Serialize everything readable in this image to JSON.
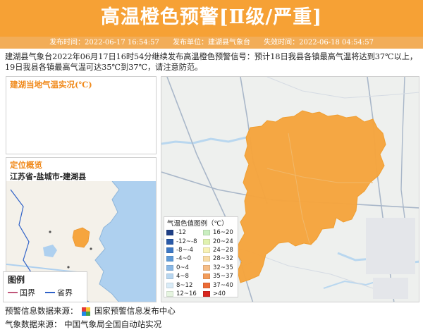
{
  "header": {
    "title": "高温橙色预警[Ⅱ级/严重]",
    "publish_time": "发布时间：2022-06-17 16:54:57",
    "publisher": "发布单位：建湖县气象台",
    "expire_time": "失效时间：2022-06-18 04:54:57"
  },
  "description": "建湖县气象台2022年06月17日16时54分继续发布高温橙色预警信号：预计18日我县各镇最高气温将达到37℃以上，19日我县各镇最高气温可达35℃到37℃，请注意防范。",
  "temp_panel": {
    "title": "建湖当地气温实况(℃)"
  },
  "location": {
    "title": "定位概览",
    "path": "江苏省-盐城市-建湖县",
    "legend_title": "图例",
    "legend_items": [
      {
        "label": "国界",
        "color": "#c0567a"
      },
      {
        "label": "省界",
        "color": "#2f62c8"
      }
    ]
  },
  "temp_legend": {
    "title": "气温色值图例（℃）",
    "items": [
      {
        "label": "-12",
        "color": "#1f3f86"
      },
      {
        "label": "16~20",
        "color": "#c9eec0"
      },
      {
        "label": "-12~-8",
        "color": "#2a5aa8"
      },
      {
        "label": "20~24",
        "color": "#e0f2b0"
      },
      {
        "label": "-8~-4",
        "color": "#3d78c4"
      },
      {
        "label": "24~28",
        "color": "#f8f2b6"
      },
      {
        "label": "-4~0",
        "color": "#5d9ad8"
      },
      {
        "label": "28~32",
        "color": "#f9dca5"
      },
      {
        "label": "0~4",
        "color": "#89b8e6"
      },
      {
        "label": "32~35",
        "color": "#f6bd86"
      },
      {
        "label": "4~8",
        "color": "#b7d6f0"
      },
      {
        "label": "35~37",
        "color": "#f39c5a"
      },
      {
        "label": "8~12",
        "color": "#d9ebf7"
      },
      {
        "label": "37~40",
        "color": "#ec6a35"
      },
      {
        "label": "12~16",
        "color": "#e6f5e0"
      },
      {
        "label": ">40",
        "color": "#d8261f"
      }
    ]
  },
  "footer": {
    "warning_source_label": "预警信息数据来源：",
    "warning_source": "国家预警信息发布中心",
    "weather_source_label": "气象数据来源：",
    "weather_source": "中国气象局全国自动站实况"
  },
  "colors": {
    "header_bg": "#f6a135",
    "meta_bg": "#f2ad58",
    "accent_title": "#f08a1c",
    "county_fill": "#f6a53e"
  }
}
